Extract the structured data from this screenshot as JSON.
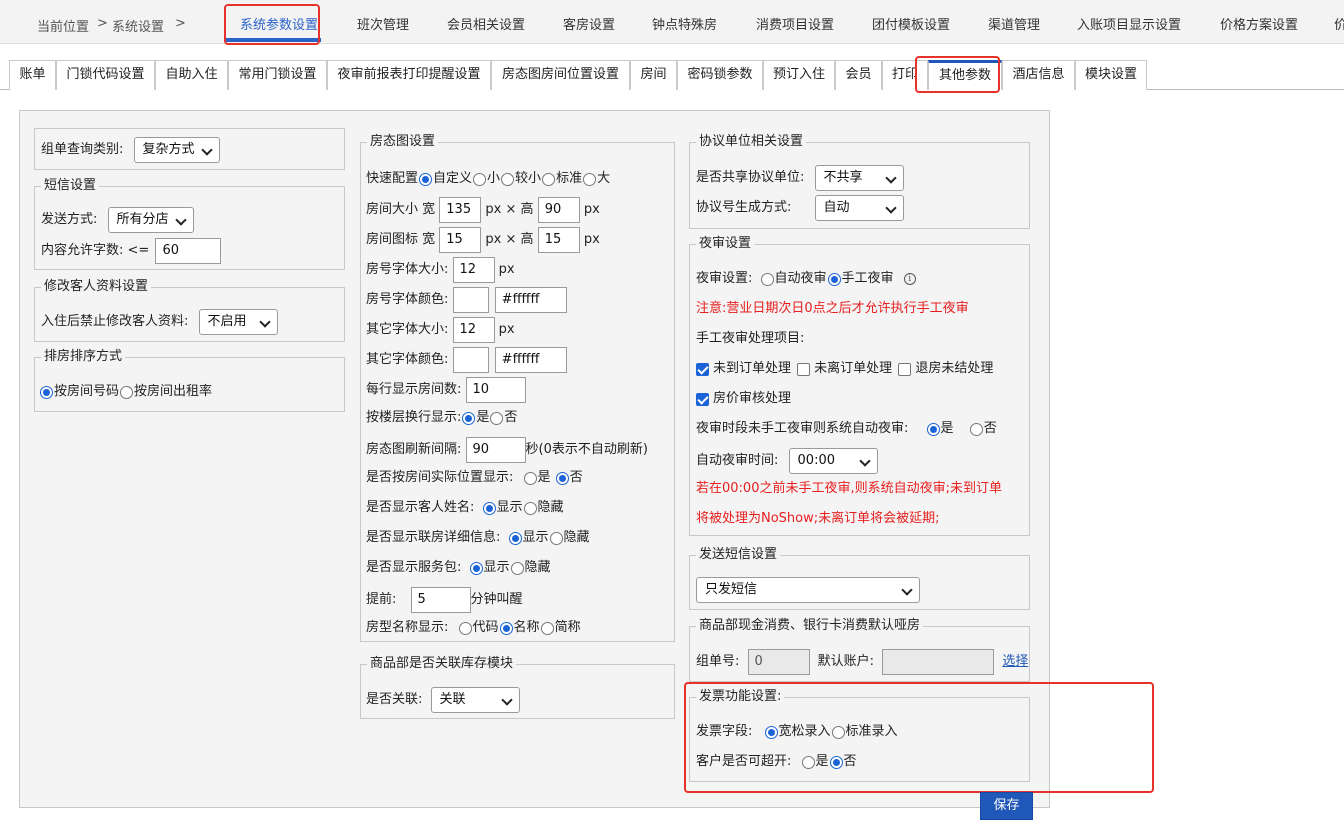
{
  "breadcrumb": {
    "label": "当前位置",
    "sep1": ">",
    "section": "系统设置",
    "sep2": ">"
  },
  "top_tabs": [
    "系统参数设置",
    "班次管理",
    "会员相关设置",
    "客房设置",
    "钟点特殊房",
    "消费项目设置",
    "团付模板设置",
    "渠道管理",
    "入账项目显示设置",
    "价格方案设置",
    "价"
  ],
  "sub_tabs": [
    "账单",
    "门锁代码设置",
    "自助入住",
    "常用门锁设置",
    "夜审前报表打印提醒设置",
    "房态图房间位置设置",
    "房间",
    "密码锁参数",
    "预订入住",
    "会员",
    "打印",
    "其他参数",
    "酒店信息",
    "模块设置"
  ],
  "col1": {
    "order_query_label": "组单查询类别:",
    "order_query_value": "复杂方式",
    "sms": {
      "legend": "短信设置",
      "send_label": "发送方式:",
      "send_value": "所有分店",
      "chars_label": "内容允许字数: <=",
      "chars_value": "60"
    },
    "guest_edit": {
      "legend": "修改客人资料设置",
      "label": "入住后禁止修改客人资料:",
      "value": "不启用"
    },
    "room_sort": {
      "legend": "排房排序方式",
      "opt1": "按房间号码",
      "opt2": "按房间出租率"
    }
  },
  "col2": {
    "room_map": {
      "legend": "房态图设置",
      "quick_label": "快速配置",
      "quick_opts": [
        "自定义",
        "小",
        "较小",
        "标准",
        "大"
      ],
      "room_size_label": "房间大小 宽",
      "room_size_w": "135",
      "px": "px",
      "times_h": "× 高",
      "room_size_h": "90",
      "icon_label": "房间图标 宽",
      "icon_w": "15",
      "icon_h": "15",
      "room_no_font_size_label": "房号字体大小:",
      "room_no_font_size": "12",
      "room_no_color_label": "房号字体颜色:",
      "room_no_color": "#ffffff",
      "other_font_size_label": "其它字体大小:",
      "other_font_size": "12",
      "other_color_label": "其它字体颜色:",
      "other_color": "#ffffff",
      "per_row_label": "每行显示房间数:",
      "per_row": "10",
      "floor_wrap_label": "按楼层换行显示:",
      "yes": "是",
      "no": "否",
      "refresh_label": "房态图刷新间隔:",
      "refresh_value": "90",
      "refresh_note": "秒(0表示不自动刷新)",
      "actual_pos_label": "是否按房间实际位置显示:",
      "guest_name_label": "是否显示客人姓名:",
      "show": "显示",
      "hide": "隐藏",
      "linked_detail_label": "是否显示联房详细信息:",
      "service_pkg_label": "是否显示服务包:",
      "advance_label": "提前:",
      "advance_value": "5",
      "advance_unit": "分钟叫醒",
      "room_type_label": "房型名称显示:",
      "room_type_opts": [
        "代码",
        "名称",
        "简称"
      ]
    },
    "inventory": {
      "legend": "商品部是否关联库存模块",
      "label": "是否关联:",
      "value": "关联"
    }
  },
  "col3": {
    "agreement": {
      "legend": "协议单位相关设置",
      "share_label": "是否共享协议单位:",
      "share_value": "不共享",
      "gen_label": "协议号生成方式:",
      "gen_value": "自动"
    },
    "night_audit": {
      "legend": "夜审设置",
      "mode_label": "夜审设置:",
      "mode_opt1": "自动夜审",
      "mode_opt2": "手工夜审",
      "info_glyph": "i",
      "notice": "注意:营业日期次日0点之后才允许执行手工夜审",
      "items_label": "手工夜审处理项目:",
      "item1": "未到订单处理",
      "item2": "未离订单处理",
      "item3": "退房未结处理",
      "item4": "房价审核处理",
      "auto_label": "夜审时段未手工夜审则系统自动夜审:",
      "yes": "是",
      "no": "否",
      "auto_time_label": "自动夜审时间:",
      "auto_time_value": "00:00",
      "warn_line1": "若在00:00之前未手工夜审,则系统自动夜审;未到订单",
      "warn_line2": "将被处理为NoShow;未离订单将会被延期;"
    },
    "sms_send": {
      "legend": "发送短信设置",
      "value": "只发短信"
    },
    "goods_default": {
      "legend": "商品部现金消费、银行卡消费默认哑房",
      "group_label": "组单号:",
      "group_value": "0",
      "account_label": "默认账户:",
      "account_value": "",
      "choose": "选择"
    },
    "invoice": {
      "legend": "发票功能设置:",
      "field_label": "发票字段:",
      "field_opt1": "宽松录入",
      "field_opt2": "标准录入",
      "over_label": "客户是否可超开:",
      "yes": "是",
      "no": "否"
    }
  },
  "save_label": "保存",
  "colors": {
    "accent": "#1f58b8",
    "highlight_box": "#e6332a",
    "warning_text": "#e61e1e"
  }
}
